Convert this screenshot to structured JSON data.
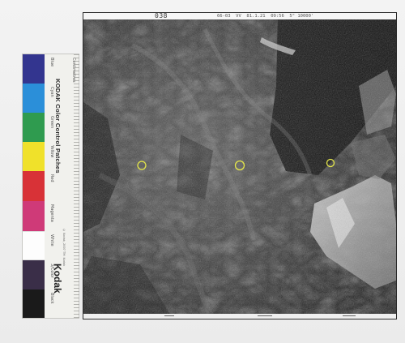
{
  "photo": {
    "frame_number": "038",
    "meta_line": "66-03  VV  81.1.21  09:56  5\" 10000'"
  },
  "kodak_strip": {
    "title": "KODAK Color Control Patches",
    "brand": "Kodak",
    "small_print": "© Kodak, 2007 TM: Kodak",
    "patches": [
      {
        "name": "Blue",
        "color": "#33358f"
      },
      {
        "name": "Cyan",
        "color": "#2b8fd9"
      },
      {
        "name": "Green",
        "color": "#2f9b4f"
      },
      {
        "name": "Yellow",
        "color": "#f0e12a"
      },
      {
        "name": "Red",
        "color": "#d83237"
      },
      {
        "name": "Magenta",
        "color": "#cf3a78"
      },
      {
        "name": "White",
        "color": "#fdfdfd"
      },
      {
        "name": "3/Color",
        "color": "#3a2e48"
      },
      {
        "name": "Black",
        "color": "#1a1a1a"
      }
    ],
    "left_labels": [
      "Blue",
      "Cyan",
      "Green",
      "Yellow",
      "Red",
      "Magenta",
      "White",
      "3/Color",
      "Black"
    ],
    "top_caption": "Centimetres"
  },
  "markers": {
    "color": "#e6e84a",
    "count": 3
  }
}
